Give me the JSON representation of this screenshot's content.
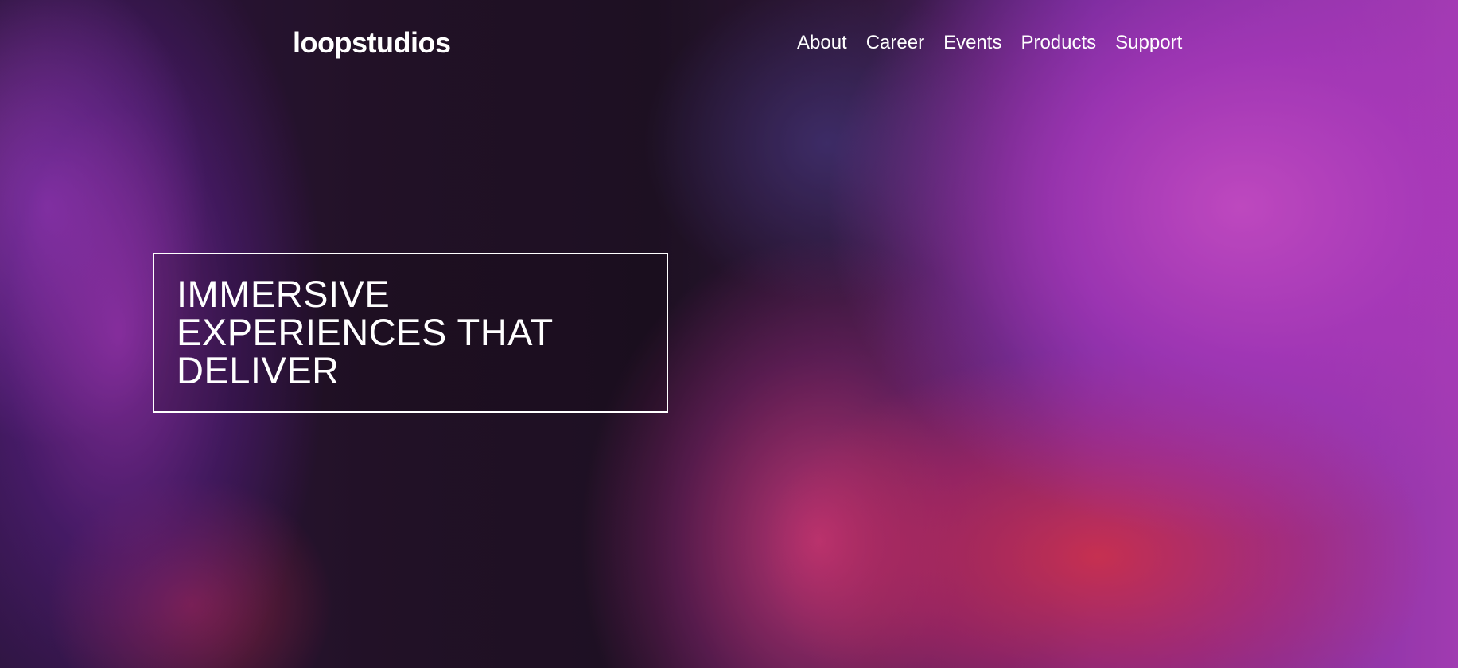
{
  "header": {
    "logo": "loopstudios",
    "nav": [
      {
        "label": "About"
      },
      {
        "label": "Career"
      },
      {
        "label": "Events"
      },
      {
        "label": "Products"
      },
      {
        "label": "Support"
      }
    ]
  },
  "hero": {
    "headline": "IMMERSIVE EXPERIENCES THAT DELIVER",
    "image": "vr-gamer-hero-image",
    "colors": {
      "text": "#ffffff",
      "border": "#ffffff",
      "accent_magenta": "#d64fe0",
      "accent_red": "#ff3c5a",
      "dark": "#24142a"
    }
  }
}
